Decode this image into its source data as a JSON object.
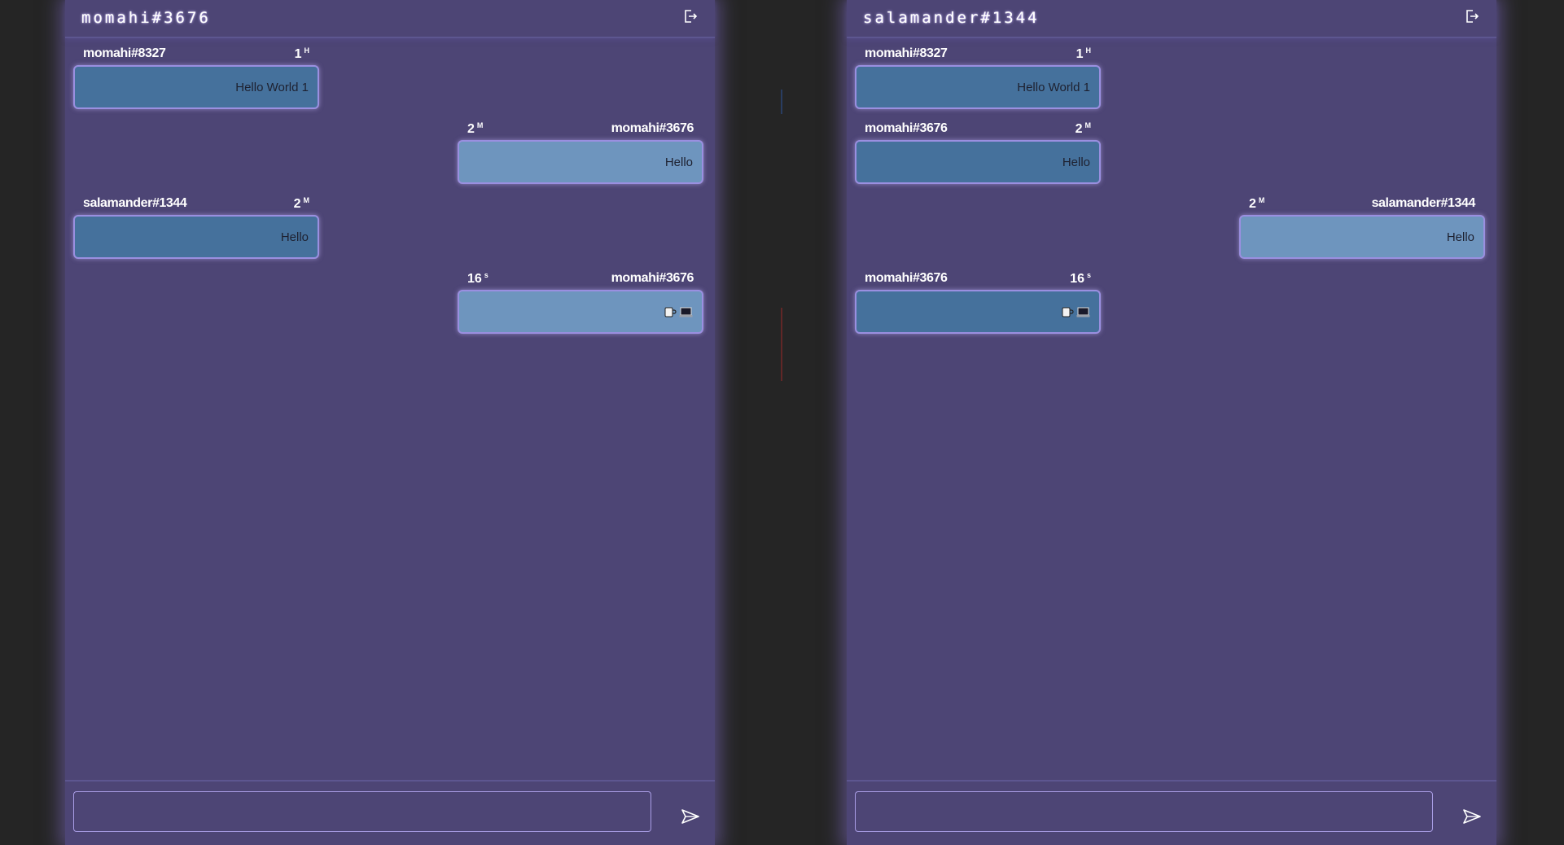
{
  "panels": [
    {
      "user": "momahi#3676",
      "messages": [
        {
          "author": "momahi#8327",
          "time": "1",
          "unit": "H",
          "text": "Hello World 1",
          "side": "left",
          "tone": "dark"
        },
        {
          "author": "momahi#3676",
          "time": "2",
          "unit": "M",
          "text": "Hello",
          "side": "right",
          "tone": "light"
        },
        {
          "author": "salamander#1344",
          "time": "2",
          "unit": "M",
          "text": "Hello",
          "side": "left",
          "tone": "dark"
        },
        {
          "author": "momahi#3676",
          "time": "16",
          "unit": "s",
          "text": "",
          "side": "right",
          "tone": "light",
          "emojis": [
            "mug-icon",
            "laptop-icon"
          ]
        }
      ],
      "input_value": ""
    },
    {
      "user": "salamander#1344",
      "messages": [
        {
          "author": "momahi#8327",
          "time": "1",
          "unit": "H",
          "text": "Hello World 1",
          "side": "left",
          "tone": "dark"
        },
        {
          "author": "momahi#3676",
          "time": "2",
          "unit": "M",
          "text": "Hello",
          "side": "left",
          "tone": "dark"
        },
        {
          "author": "salamander#1344",
          "time": "2",
          "unit": "M",
          "text": "Hello",
          "side": "right",
          "tone": "light"
        },
        {
          "author": "momahi#3676",
          "time": "16",
          "unit": "s",
          "text": "",
          "side": "left",
          "tone": "dark",
          "emojis": [
            "mug-icon",
            "laptop-icon"
          ]
        }
      ],
      "input_value": ""
    }
  ],
  "icons": {
    "logout": "logout-icon",
    "send": "send-icon"
  },
  "colors": {
    "panel_bg": "#4d4575",
    "bubble_own": "#6e95be",
    "bubble_other": "#45719c",
    "glow": "#9a8fe0"
  }
}
